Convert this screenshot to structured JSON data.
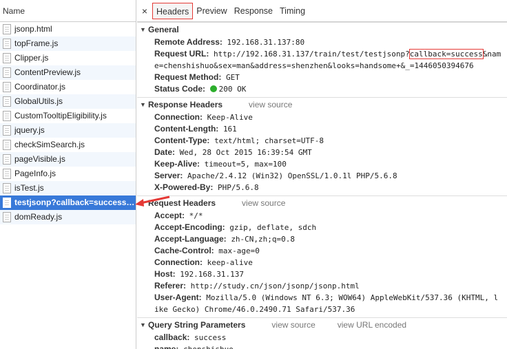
{
  "left": {
    "column_header": "Name",
    "files": [
      "jsonp.html",
      "topFrame.js",
      "Clipper.js",
      "ContentPreview.js",
      "Coordinator.js",
      "GlobalUtils.js",
      "CustomTooltipEligibility.js",
      "jquery.js",
      "checkSimSearch.js",
      "pageVisible.js",
      "PageInfo.js",
      "isTest.js",
      "testjsonp?callback=success&n...",
      "domReady.js"
    ],
    "selected_index": 12
  },
  "tabs": {
    "close": "×",
    "items": [
      "Headers",
      "Preview",
      "Response",
      "Timing"
    ],
    "active": "Headers"
  },
  "general": {
    "title": "General",
    "remote_address_key": "Remote Address:",
    "remote_address": "192.168.31.137:80",
    "request_url_key": "Request URL:",
    "request_url_pre": "http://192.168.31.137/train/test/testjsonp?",
    "request_url_hl": "callback=success",
    "request_url_post": "&name=chenshishuo&sex=man&address=shenzhen&looks=handsome+&_=1446050394676",
    "request_method_key": "Request Method:",
    "request_method": "GET",
    "status_code_key": "Status Code:",
    "status_code": "200 OK"
  },
  "response_headers": {
    "title": "Response Headers",
    "view_source": "view source",
    "items": [
      {
        "k": "Connection:",
        "v": "Keep-Alive"
      },
      {
        "k": "Content-Length:",
        "v": "161"
      },
      {
        "k": "Content-Type:",
        "v": "text/html; charset=UTF-8"
      },
      {
        "k": "Date:",
        "v": "Wed, 28 Oct 2015 16:39:54 GMT"
      },
      {
        "k": "Keep-Alive:",
        "v": "timeout=5, max=100"
      },
      {
        "k": "Server:",
        "v": "Apache/2.4.12 (Win32) OpenSSL/1.0.1l PHP/5.6.8"
      },
      {
        "k": "X-Powered-By:",
        "v": "PHP/5.6.8"
      }
    ]
  },
  "request_headers": {
    "title": "Request Headers",
    "view_source": "view source",
    "items": [
      {
        "k": "Accept:",
        "v": "*/*"
      },
      {
        "k": "Accept-Encoding:",
        "v": "gzip, deflate, sdch"
      },
      {
        "k": "Accept-Language:",
        "v": "zh-CN,zh;q=0.8"
      },
      {
        "k": "Cache-Control:",
        "v": "max-age=0"
      },
      {
        "k": "Connection:",
        "v": "keep-alive"
      },
      {
        "k": "Host:",
        "v": "192.168.31.137"
      },
      {
        "k": "Referer:",
        "v": "http://study.cn/json/jsonp/jsonp.html"
      },
      {
        "k": "User-Agent:",
        "v": "Mozilla/5.0 (Windows NT 6.3; WOW64) AppleWebKit/537.36 (KHTML, like Gecko) Chrome/46.0.2490.71 Safari/537.36"
      }
    ]
  },
  "query_string": {
    "title": "Query String Parameters",
    "view_source": "view source",
    "view_url_encoded": "view URL encoded",
    "items": [
      {
        "k": "callback:",
        "v": "success"
      },
      {
        "k": "name:",
        "v": "chenshishuo"
      }
    ]
  },
  "colors": {
    "selected_row": "#3879d9",
    "annotation": "#e53935",
    "status_ok": "#2cae2c"
  }
}
